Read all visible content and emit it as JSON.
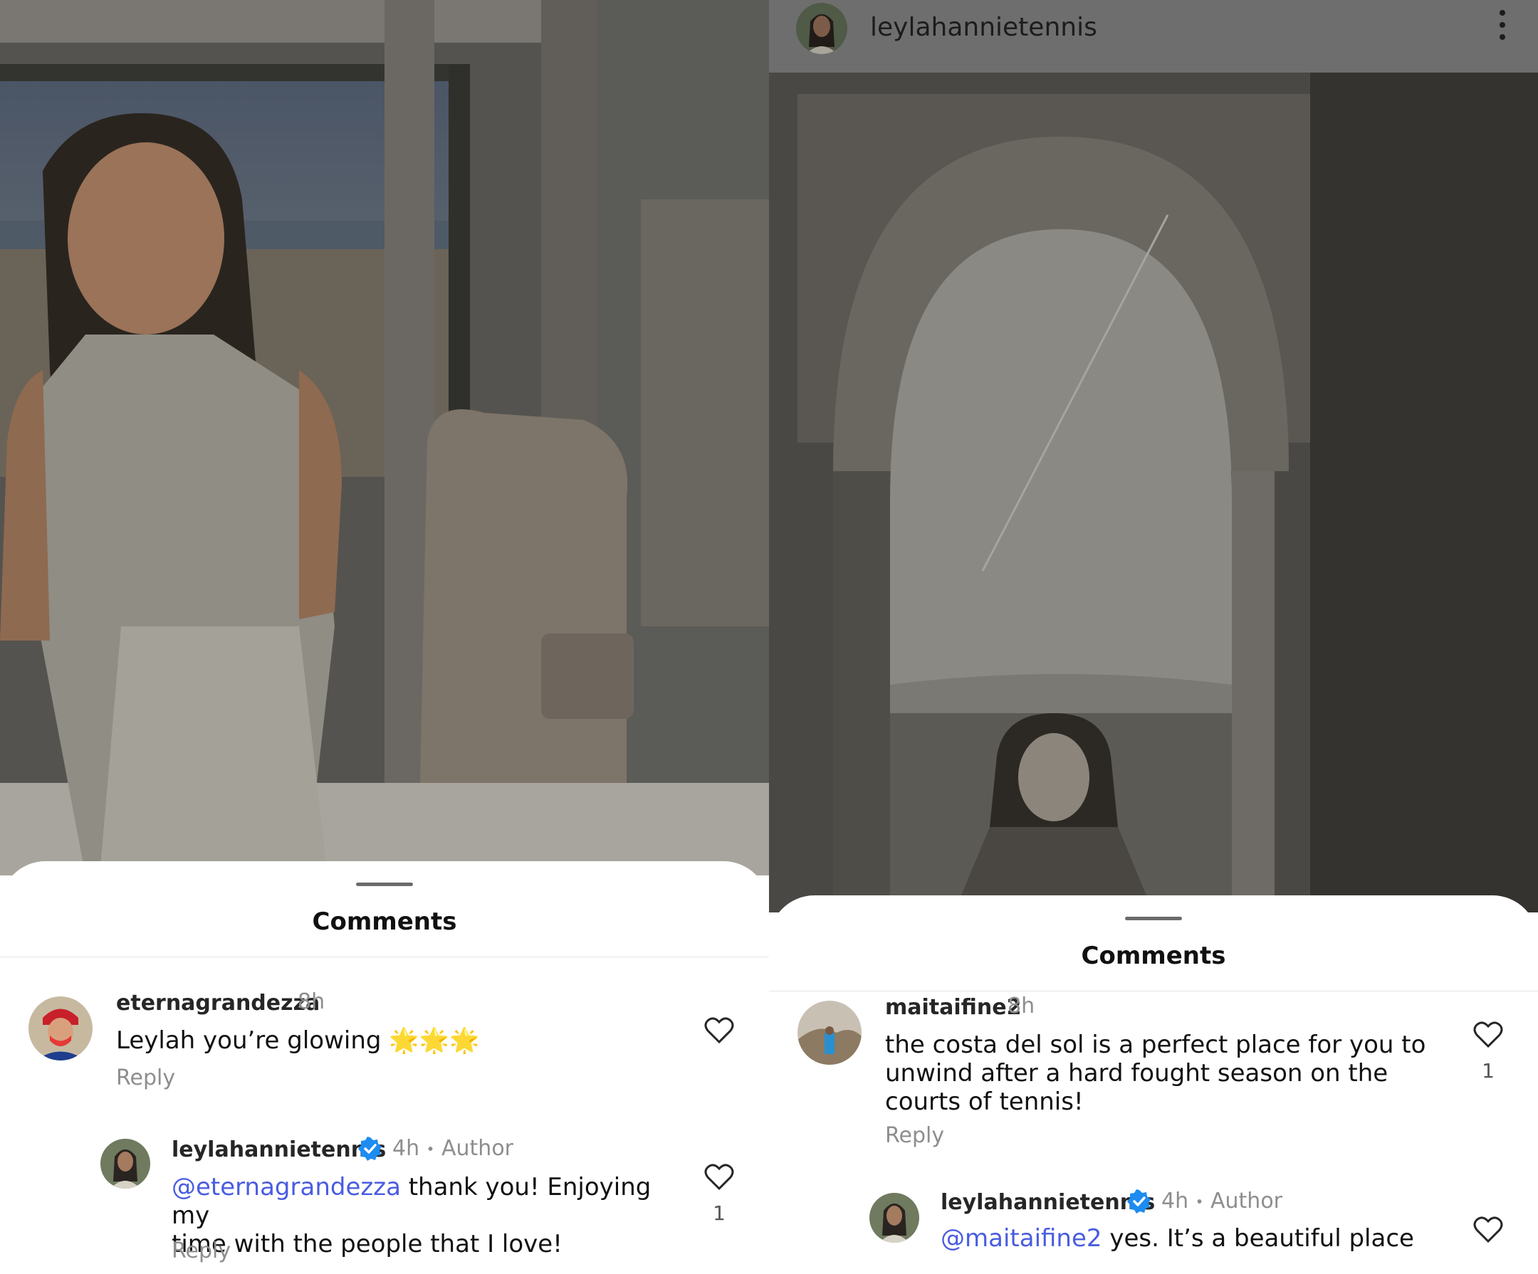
{
  "left": {
    "sheet_title": "Comments",
    "comment": {
      "username": "eternagrandezza",
      "time": "8h",
      "text": "Leylah you’re glowing 🌟🌟🌟",
      "reply_label": "Reply",
      "avatar": "profile-avatar"
    },
    "reply": {
      "username": "leylahannietennis",
      "time": "4h",
      "separator": "•",
      "author_label": "Author",
      "mention": "@eternagrandezza",
      "text_line1": " thank you! Enjoying my",
      "text_line2": "time with the people that I love!",
      "reply_label": "Reply",
      "likes": "1"
    }
  },
  "right": {
    "header": {
      "username": "leylahannietennis",
      "menu_icon": "more-vertical-icon"
    },
    "sheet_title": "Comments",
    "comment": {
      "username": "maitaifine2",
      "time": "8h",
      "text_line1": "the costa del sol is a perfect place for you to",
      "text_line2": "unwind after a hard fought season on the",
      "text_line3": "courts of tennis!",
      "reply_label": "Reply",
      "likes": "1"
    },
    "reply": {
      "username": "leylahannietennis",
      "time": "4h",
      "separator": "•",
      "author_label": "Author",
      "mention": "@maitaifine2",
      "text": " yes. It’s a beautiful place"
    }
  },
  "colors": {
    "mention": "#4a5ce0",
    "verified": "#1d8cf0",
    "muted": "#8e8e8e"
  }
}
